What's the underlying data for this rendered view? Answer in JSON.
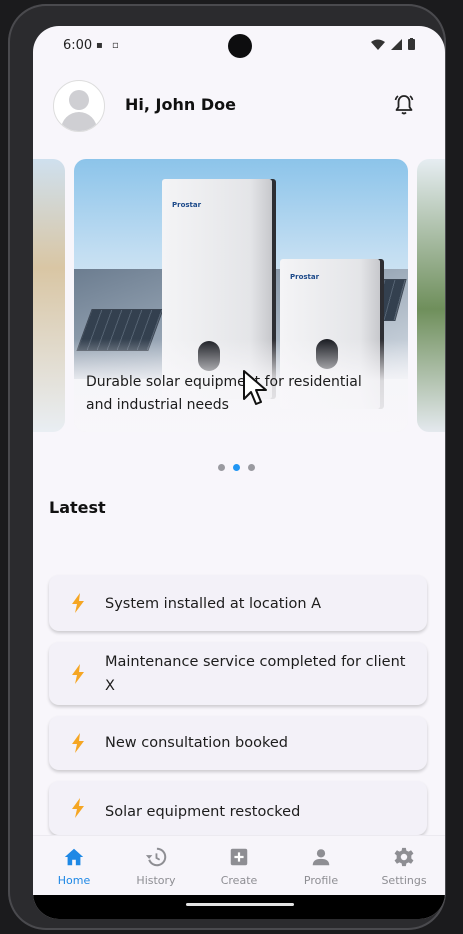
{
  "status_bar": {
    "time": "6:00"
  },
  "header": {
    "greeting": "Hi, John Doe"
  },
  "carousel": {
    "caption": "Durable solar equipment for residential and industrial needs",
    "brand": "Prostar",
    "active_index": 1,
    "count": 3
  },
  "latest": {
    "title": "Latest",
    "items": [
      {
        "text": "System installed at location A",
        "icon": "bolt-icon"
      },
      {
        "text": "Maintenance service completed for client X",
        "icon": "bolt-icon"
      },
      {
        "text": "New consultation booked",
        "icon": "bolt-icon"
      },
      {
        "text": "Solar equipment restocked",
        "icon": "bolt-icon"
      }
    ]
  },
  "nav": {
    "items": [
      {
        "label": "Home",
        "icon": "home-icon",
        "active": true
      },
      {
        "label": "History",
        "icon": "history-icon",
        "active": false
      },
      {
        "label": "Create",
        "icon": "add-box-icon",
        "active": false
      },
      {
        "label": "Profile",
        "icon": "person-icon",
        "active": false
      },
      {
        "label": "Settings",
        "icon": "gear-icon",
        "active": false
      }
    ]
  },
  "colors": {
    "accent": "#1e88e5",
    "bolt": "#f5a623",
    "background": "#f8f6fb"
  }
}
